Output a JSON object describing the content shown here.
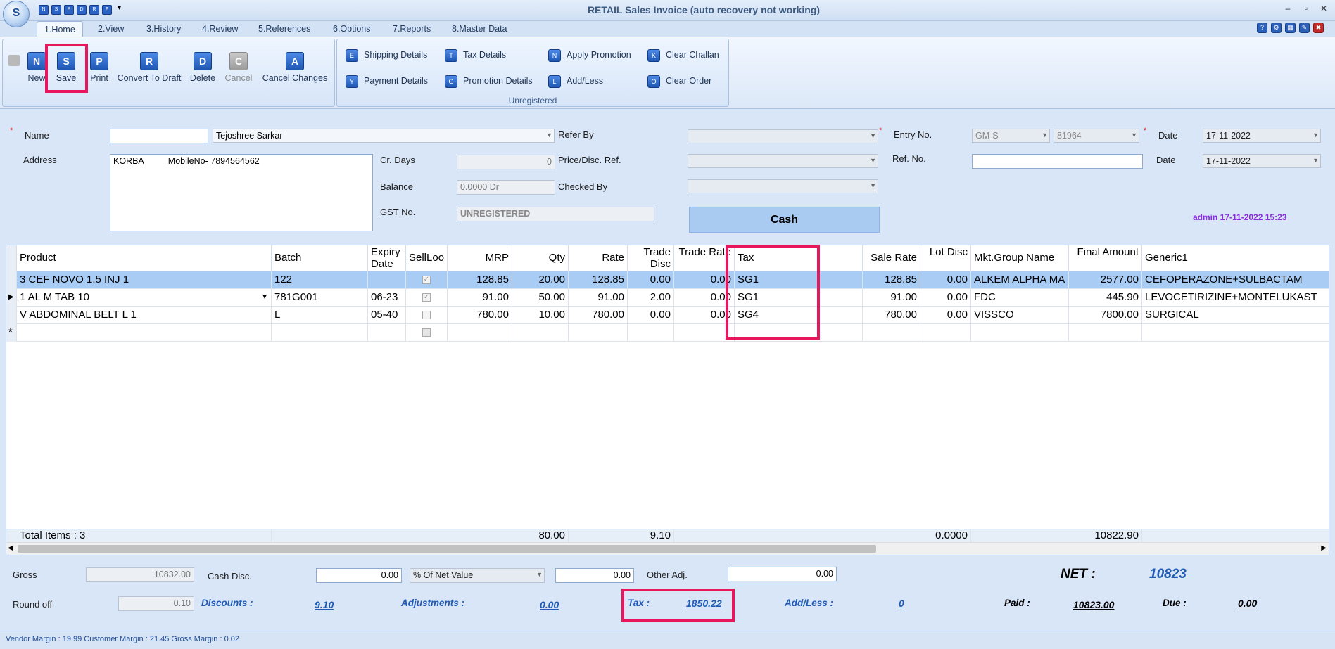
{
  "window": {
    "title": "RETAIL Sales Invoice (auto recovery not working)",
    "logo_letters": "S",
    "quick_access": [
      "N",
      "S",
      "P",
      "D",
      "R",
      "F"
    ]
  },
  "tabs": [
    "1.Home",
    "2.View",
    "3.History",
    "4.Review",
    "5.References",
    "6.Options",
    "7.Reports",
    "8.Master Data"
  ],
  "ribbon": {
    "main_buttons": [
      {
        "label": "New",
        "glyph": "N"
      },
      {
        "label": "Save",
        "glyph": "S"
      },
      {
        "label": "Print",
        "glyph": "P"
      },
      {
        "label": "Convert To Draft",
        "glyph": "R"
      },
      {
        "label": "Delete",
        "glyph": "D"
      },
      {
        "label": "Cancel",
        "glyph": "C",
        "disabled": true
      },
      {
        "label": "Cancel Changes",
        "glyph": "A"
      }
    ],
    "small_buttons": [
      {
        "label": "Shipping Details",
        "glyph": "E"
      },
      {
        "label": "Tax Details",
        "glyph": "T"
      },
      {
        "label": "Apply Promotion",
        "glyph": "N"
      },
      {
        "label": "Clear Challan",
        "glyph": "K"
      },
      {
        "label": "Payment Details",
        "glyph": "Y"
      },
      {
        "label": "Promotion Details",
        "glyph": "G"
      },
      {
        "label": "Add/Less",
        "glyph": "L"
      },
      {
        "label": "Clear Order",
        "glyph": "O"
      }
    ],
    "group_caption": "Unregistered"
  },
  "form": {
    "name_label": "Name",
    "name_code": "",
    "name_value": "Tejoshree Sarkar",
    "address_label": "Address",
    "address_value": "KORBA          MobileNo- 7894564562",
    "cr_days_label": "Cr. Days",
    "cr_days_value": "0",
    "balance_label": "Balance",
    "balance_value": "0.0000 Dr",
    "gst_label": "GST No.",
    "gst_value": "UNREGISTERED",
    "refer_by_label": "Refer By",
    "price_ref_label": "Price/Disc. Ref.",
    "checked_by_label": "Checked By",
    "cash_label": "Cash",
    "entry_no_label": "Entry No.",
    "entry_prefix": "GM-S-",
    "entry_no": "81964",
    "ref_no_label": "Ref. No.",
    "date_label": "Date",
    "date1": "17-11-2022",
    "date2": "17-11-2022",
    "admin_info": "admin 17-11-2022 15:23"
  },
  "grid": {
    "headers": [
      "Product",
      "Batch",
      "Expiry Date",
      "SellLoo",
      "MRP",
      "Qty",
      "Rate",
      "Trade Disc",
      "Trade Rate",
      "Tax",
      "Sale Rate",
      "Lot Disc",
      "Mkt.Group Name",
      "Final Amount",
      "Generic1"
    ],
    "rows": [
      [
        "3 CEF NOVO 1.5 INJ 1",
        "122",
        "",
        "checked",
        "128.85",
        "20.00",
        "128.85",
        "0.00",
        "0.00",
        "SG1",
        "128.85",
        "0.00",
        "ALKEM ALPHA MA",
        "2577.00",
        "CEFOPERAZONE+SULBACTAM"
      ],
      [
        "1 AL M TAB 10",
        "781G001",
        "06-23",
        "checked",
        "91.00",
        "50.00",
        "91.00",
        "2.00",
        "0.00",
        "SG1",
        "91.00",
        "0.00",
        "FDC",
        "445.90",
        "LEVOCETIRIZINE+MONTELUKAST"
      ],
      [
        "V ABDOMINAL BELT L 1",
        "L",
        "05-40",
        "",
        "780.00",
        "10.00",
        "780.00",
        "0.00",
        "0.00",
        "SG4",
        "780.00",
        "0.00",
        "VISSCO",
        "7800.00",
        "SURGICAL"
      ]
    ],
    "totals": {
      "label": "Total Items : 3",
      "qty": "80.00",
      "trade_disc": "9.10",
      "lot_disc": "0.0000",
      "final_amount": "10822.90"
    }
  },
  "footer": {
    "gross_label": "Gross",
    "gross_value": "10832.00",
    "cash_disc_label": "Cash Disc.",
    "cash_disc_value": "0.00",
    "disc_mode": "% Of Net Value",
    "disc_amount": "0.00",
    "other_adj_label": "Other Adj.",
    "other_adj_value": "0.00",
    "net_label": "NET :",
    "net_value": "10823",
    "round_off_label": "Round off",
    "round_off_value": "0.10",
    "discounts_label": "Discounts :",
    "discounts_value": "9.10",
    "adjustments_label": "Adjustments :",
    "adjustments_value": "0.00",
    "tax_label": "Tax :",
    "tax_value": "1850.22",
    "addless_label": "Add/Less :",
    "addless_value": "0",
    "paid_label": "Paid :",
    "paid_value": "10823.00",
    "due_label": "Due :",
    "due_value": "0.00"
  },
  "status": "Vendor Margin : 19.99 Customer Margin : 21.45 Gross Margin : 0.02",
  "colors": {
    "highlight": "#e8175d",
    "accent": "#1f5bb5",
    "admin": "#8a2be2"
  }
}
